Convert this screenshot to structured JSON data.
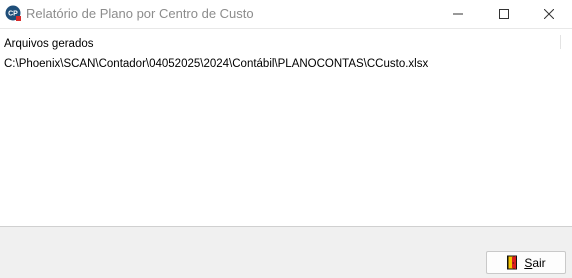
{
  "window": {
    "title": "Relatório de Plano por Centro de Custo",
    "app_icon_text": "CP"
  },
  "content": {
    "lines": [
      "Arquivos gerados",
      "C:\\Phoenix\\SCAN\\Contador\\04052025\\2024\\Contábil\\PLANOCONTAS\\CCusto.xlsx"
    ]
  },
  "footer": {
    "exit_button": {
      "mnemonic": "S",
      "rest": "air",
      "icon": "exit-door-icon"
    }
  },
  "colors": {
    "app_icon_bg": "#1f4e79",
    "app_icon_badge": "#d62b2b",
    "title_text": "#8c8c8c",
    "panel_bg": "#f0f0f0"
  }
}
